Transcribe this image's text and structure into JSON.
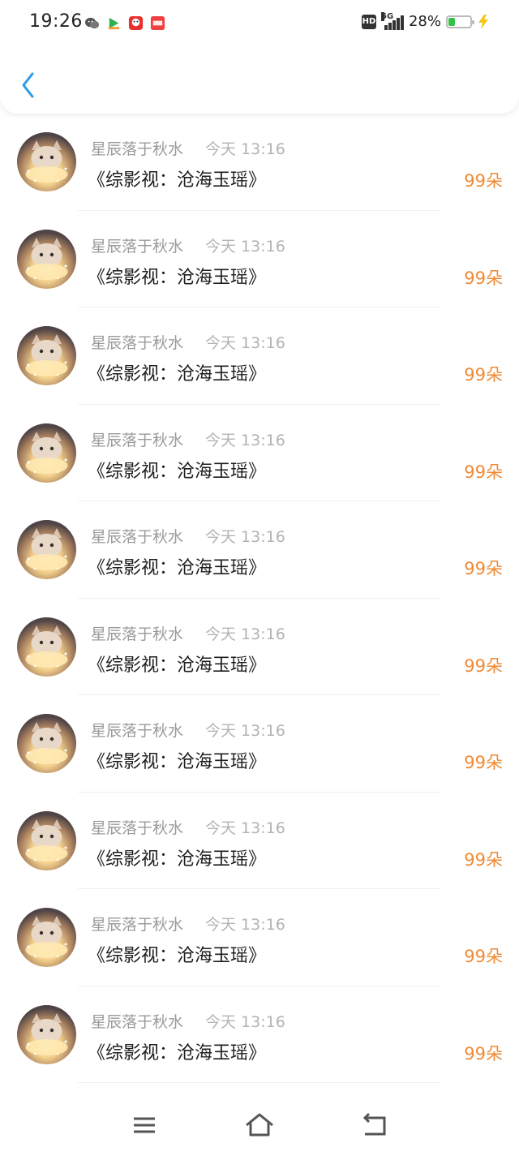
{
  "status_bar": {
    "time": "19:26",
    "network": "5G",
    "hd": "HD",
    "battery": "28%",
    "notification_icons": [
      "wechat-icon",
      "app-icon",
      "app-icon",
      "toutiao-icon"
    ]
  },
  "header": {
    "back_icon": "chevron-left-icon",
    "accent_color": "#2a9ce8"
  },
  "items": [
    {
      "name": "星辰落于秋水",
      "time": "今天 13:16",
      "title": "《综影视：沧海玉瑶》",
      "amount": "99朵"
    },
    {
      "name": "星辰落于秋水",
      "time": "今天 13:16",
      "title": "《综影视：沧海玉瑶》",
      "amount": "99朵"
    },
    {
      "name": "星辰落于秋水",
      "time": "今天 13:16",
      "title": "《综影视：沧海玉瑶》",
      "amount": "99朵"
    },
    {
      "name": "星辰落于秋水",
      "time": "今天 13:16",
      "title": "《综影视：沧海玉瑶》",
      "amount": "99朵"
    },
    {
      "name": "星辰落于秋水",
      "time": "今天 13:16",
      "title": "《综影视：沧海玉瑶》",
      "amount": "99朵"
    },
    {
      "name": "星辰落于秋水",
      "time": "今天 13:16",
      "title": "《综影视：沧海玉瑶》",
      "amount": "99朵"
    },
    {
      "name": "星辰落于秋水",
      "time": "今天 13:16",
      "title": "《综影视：沧海玉瑶》",
      "amount": "99朵"
    },
    {
      "name": "星辰落于秋水",
      "time": "今天 13:16",
      "title": "《综影视：沧海玉瑶》",
      "amount": "99朵"
    },
    {
      "name": "星辰落于秋水",
      "time": "今天 13:16",
      "title": "《综影视：沧海玉瑶》",
      "amount": "99朵"
    },
    {
      "name": "星辰落于秋水",
      "time": "今天 13:16",
      "title": "《综影视：沧海玉瑶》",
      "amount": "99朵"
    }
  ],
  "colors": {
    "amount": "#f08a35",
    "name": "#9a9a9a",
    "title": "#1e1e1e"
  },
  "nav_bar": {
    "icons": [
      "menu-icon",
      "home-icon",
      "back-icon"
    ]
  }
}
